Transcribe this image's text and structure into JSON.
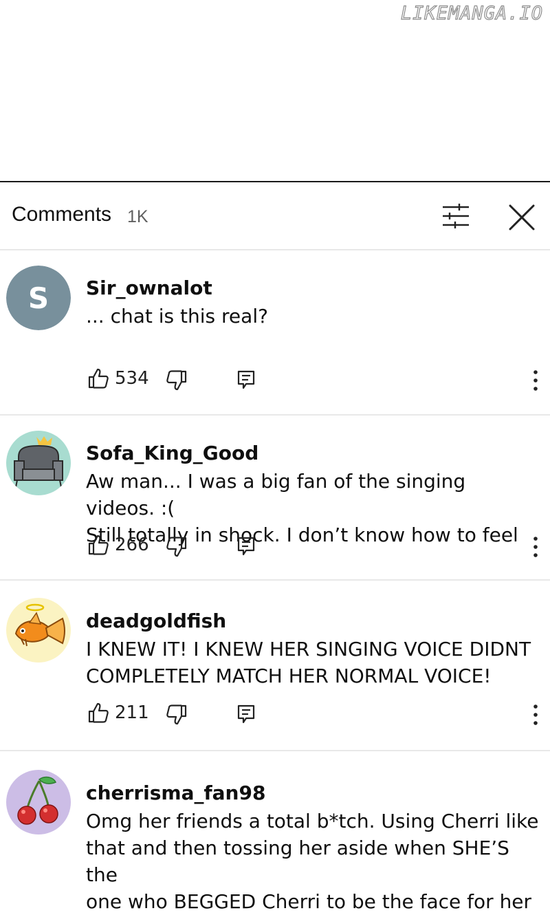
{
  "watermark": "LIKEMANGA.IO",
  "header": {
    "title": "Comments",
    "count": "1K"
  },
  "comments": [
    {
      "username": "Sir_ownalot",
      "avatar_letter": "S",
      "lines": [
        "... chat is this real?"
      ],
      "likes": "534"
    },
    {
      "username": "Sofa_King_Good",
      "avatar_icon": "armchair-avatar-icon",
      "lines": [
        "Aw man... I was a big fan of the singing videos. :(",
        "Still totally in shock. I don’t know how to feel"
      ],
      "likes": "266"
    },
    {
      "username": "deadgoldfish",
      "avatar_icon": "goldfish-avatar-icon",
      "lines": [
        "I KNEW IT! I KNEW HER SINGING VOICE DIDNT",
        "COMPLETELY MATCH HER NORMAL VOICE!"
      ],
      "likes": "211"
    },
    {
      "username": "cherrisma_fan98",
      "avatar_icon": "cherry-avatar-icon",
      "lines": [
        "Omg her friends a total b*tch. Using Cherri like",
        "that and then tossing her aside when SHE’S the",
        "one who BEGGED Cherri to be the face for her"
      ]
    }
  ],
  "colors": {
    "avatar_s": "#78909c",
    "avatar_sofa": "#a8dcd0",
    "avatar_fish": "#fbf3c2",
    "avatar_cherry": "#ccbde6"
  }
}
